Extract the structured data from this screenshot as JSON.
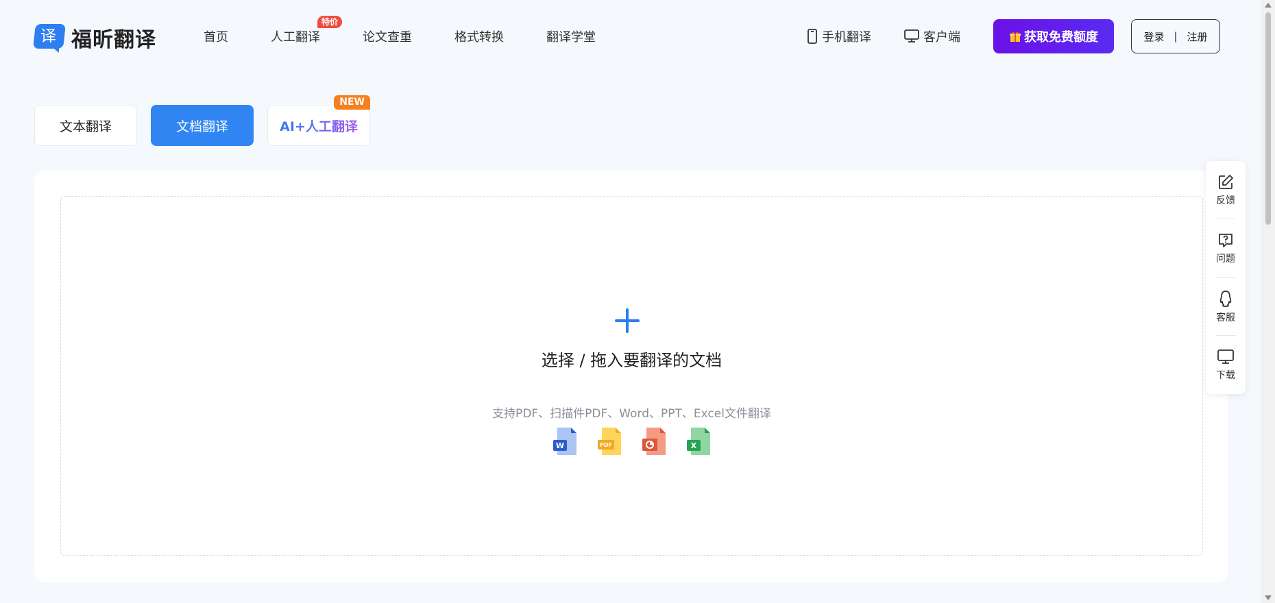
{
  "header": {
    "logo_glyph": "译",
    "logo_text": "福昕翻译",
    "nav": [
      {
        "label": "首页"
      },
      {
        "label": "人工翻译",
        "badge": "特价"
      },
      {
        "label": "论文查重"
      },
      {
        "label": "格式转换"
      },
      {
        "label": "翻译学堂"
      }
    ],
    "mobile_label": "手机翻译",
    "client_label": "客户端",
    "free_quota_label": "获取免费额度",
    "login_label": "登录",
    "login_sep": "|",
    "register_label": "注册"
  },
  "tabs": [
    {
      "label": "文本翻译"
    },
    {
      "label": "文档翻译",
      "active": true
    },
    {
      "label": "AI+人工翻译",
      "badge": "NEW"
    }
  ],
  "upload": {
    "title": "选择 / 拖入要翻译的文档",
    "subtitle": "支持PDF、扫描件PDF、Word、PPT、Excel文件翻译",
    "file_types": [
      {
        "icon": "word-file-icon",
        "label": "W",
        "color": "#2b5ec9",
        "paper": "#a9c4f5"
      },
      {
        "icon": "pdf-file-icon",
        "label": "PDF",
        "color": "#f4a820",
        "paper": "#fcd55a"
      },
      {
        "icon": "ppt-file-icon",
        "label": "",
        "color": "#e0563a",
        "paper": "#f59a83"
      },
      {
        "icon": "excel-file-icon",
        "label": "X",
        "color": "#22a552",
        "paper": "#8fd6a2"
      }
    ]
  },
  "sidebar": [
    {
      "label": "反馈",
      "icon": "edit-icon"
    },
    {
      "label": "问题",
      "icon": "question-icon"
    },
    {
      "label": "客服",
      "icon": "qq-icon"
    },
    {
      "label": "下载",
      "icon": "monitor-icon"
    }
  ],
  "colors": {
    "primary": "#3185f2",
    "accent_purple": "#6a11e8",
    "badge_red": "#f24a40",
    "badge_orange": "#f5801f"
  }
}
